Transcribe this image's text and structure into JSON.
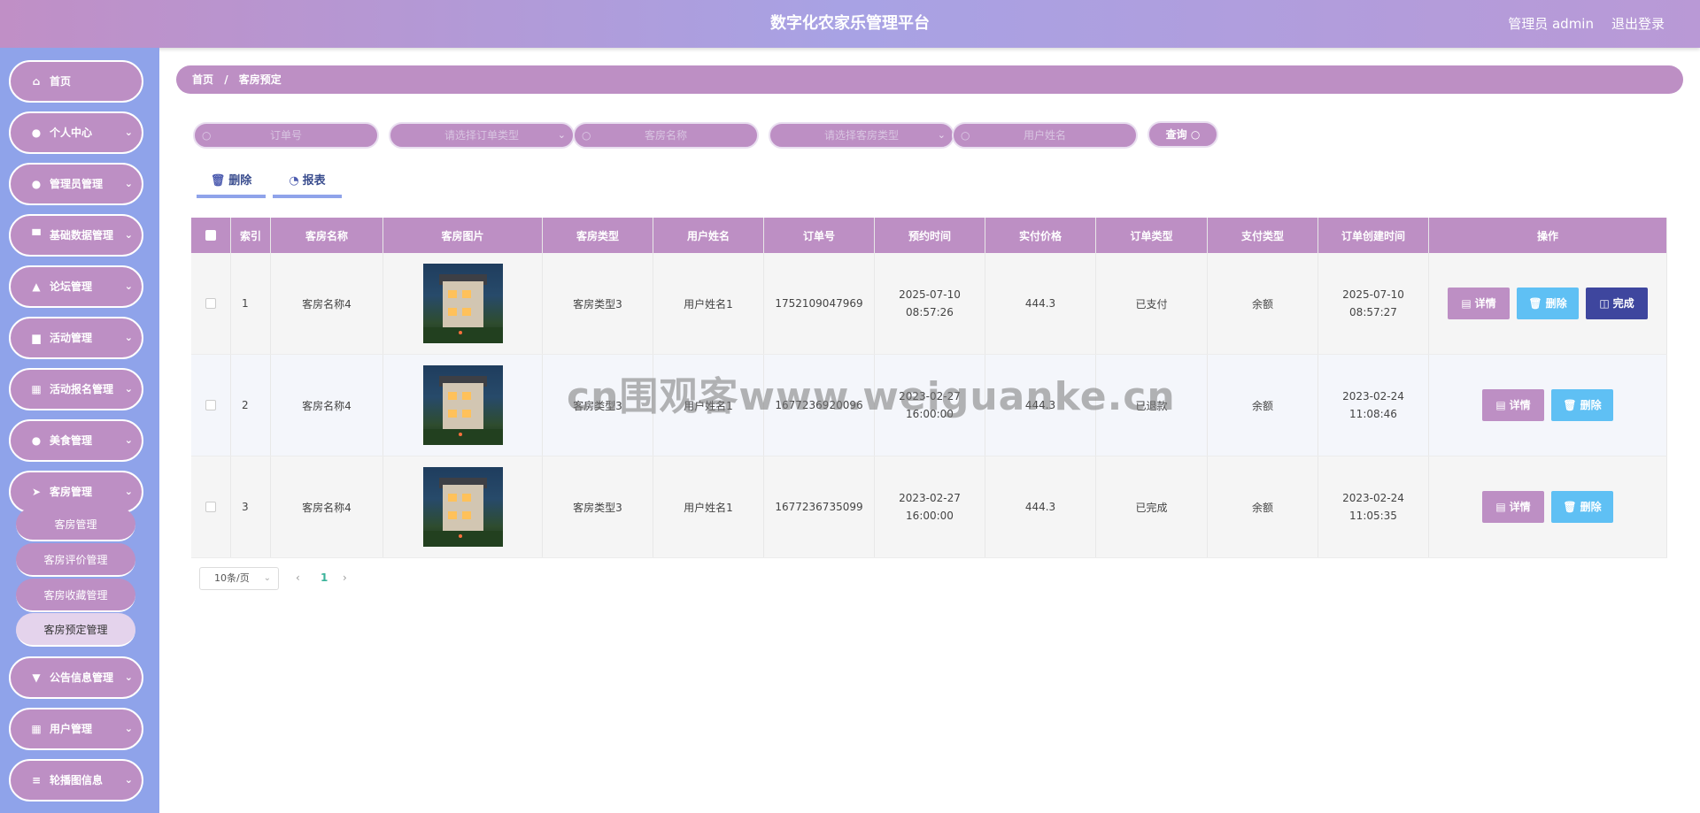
{
  "header": {
    "title": "数字化农家乐管理平台",
    "admin": "管理员 admin",
    "logout": "退出登录"
  },
  "sidebar": {
    "items": [
      {
        "label": "首页",
        "icon": "home-icon",
        "glyph": "⌂",
        "chevron": ""
      },
      {
        "label": "个人中心",
        "icon": "user-icon",
        "glyph": "●",
        "chevron": "⌄"
      },
      {
        "label": "管理员管理",
        "icon": "user-icon",
        "glyph": "●",
        "chevron": "⌄"
      },
      {
        "label": "基础数据管理",
        "icon": "monitor-icon",
        "glyph": "▀",
        "chevron": "⌄"
      },
      {
        "label": "论坛管理",
        "icon": "thumbs-up-icon",
        "glyph": "▲",
        "chevron": "⌄"
      },
      {
        "label": "活动管理",
        "icon": "briefcase-icon",
        "glyph": "▆",
        "chevron": "⌄"
      },
      {
        "label": "活动报名管理",
        "icon": "grid-icon",
        "glyph": "▦",
        "chevron": "⌄"
      },
      {
        "label": "美食管理",
        "icon": "user-icon",
        "glyph": "●",
        "chevron": "⌄"
      },
      {
        "label": "客房管理",
        "icon": "send-icon",
        "glyph": "➤",
        "chevron": "⌄"
      },
      {
        "label": "公告信息管理",
        "icon": "pin-icon",
        "glyph": "▼",
        "chevron": "⌄"
      },
      {
        "label": "用户管理",
        "icon": "grid-icon",
        "glyph": "▦",
        "chevron": "⌄"
      },
      {
        "label": "轮播图信息",
        "icon": "sliders-icon",
        "glyph": "≡",
        "chevron": "⌄"
      }
    ],
    "subitems": [
      "客房管理",
      "客房评价管理",
      "客房收藏管理",
      "客房预定管理"
    ]
  },
  "breadcrumb": {
    "home": "首页",
    "sep": "/",
    "current": "客房预定"
  },
  "search": {
    "order_no": "订单号",
    "order_type": "请选择订单类型",
    "room_name": "客房名称",
    "room_type": "请选择客房类型",
    "user_name": "用户姓名",
    "query": "查询",
    "search_glyph": "○",
    "chevron_glyph": "⌄"
  },
  "actions": {
    "delete": "删除",
    "report": "报表",
    "delete_glyph": "🗑",
    "report_glyph": "◔"
  },
  "table": {
    "headers": [
      "索引",
      "客房名称",
      "客房图片",
      "客房类型",
      "用户姓名",
      "订单号",
      "预约时间",
      "实付价格",
      "订单类型",
      "支付类型",
      "订单创建时间",
      "操作"
    ],
    "rows": [
      {
        "index": "1",
        "room_name": "客房名称4",
        "room_type": "客房类型3",
        "user_name": "用户姓名1",
        "order_no": "1752109047969",
        "reserve_time": "2025-07-10 08:57:26",
        "price": "444.3",
        "order_type": "已支付",
        "pay_type": "余额",
        "created": "2025-07-10 08:57:27",
        "ops": [
          "详情",
          "删除",
          "完成"
        ]
      },
      {
        "index": "2",
        "room_name": "客房名称4",
        "room_type": "客房类型3",
        "user_name": "用户姓名1",
        "order_no": "1677236920096",
        "reserve_time": "2023-02-27 16:00:00",
        "price": "444.3",
        "order_type": "已退款",
        "pay_type": "余额",
        "created": "2023-02-24 11:08:46",
        "ops": [
          "详情",
          "删除"
        ]
      },
      {
        "index": "3",
        "room_name": "客房名称4",
        "room_type": "客房类型3",
        "user_name": "用户姓名1",
        "order_no": "1677236735099",
        "reserve_time": "2023-02-27 16:00:00",
        "price": "444.3",
        "order_type": "已完成",
        "pay_type": "余额",
        "created": "2023-02-24 11:05:35",
        "ops": [
          "详情",
          "删除"
        ]
      }
    ]
  },
  "op_glyphs": {
    "detail": "▤",
    "delete": "🗑",
    "finish": "◫"
  },
  "pagination": {
    "page_size": "10条/页",
    "prev": "‹",
    "current": "1",
    "next": "›"
  },
  "watermark": "cn围观客www.weiguanke.cn"
}
